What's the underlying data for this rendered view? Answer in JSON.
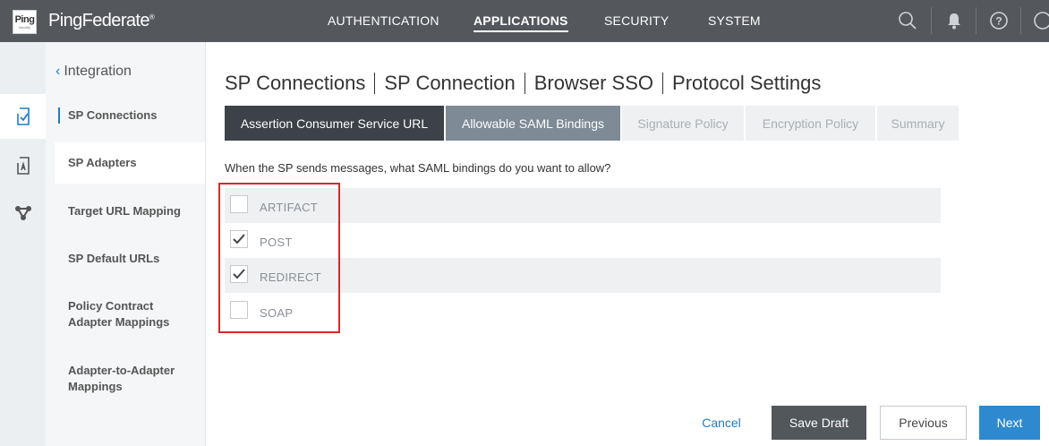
{
  "logo": {
    "line1": "Ping",
    "line2": "Identity"
  },
  "brand": {
    "name": "PingFederate",
    "mark": "®"
  },
  "topnav": {
    "items": [
      {
        "label": "AUTHENTICATION"
      },
      {
        "label": "APPLICATIONS",
        "active": true
      },
      {
        "label": "SECURITY"
      },
      {
        "label": "SYSTEM"
      }
    ],
    "icons": [
      "search-icon",
      "bell-icon",
      "help-icon",
      "user-icon"
    ]
  },
  "rail": {
    "icons": [
      "sp-connections-icon",
      "sp-adapters-icon",
      "federation-icon"
    ]
  },
  "subnav": {
    "back_label": "Integration",
    "items": [
      {
        "label": "SP Connections"
      },
      {
        "label": "SP Adapters"
      },
      {
        "label": "Target URL Mapping"
      },
      {
        "label": "SP Default URLs"
      },
      {
        "label": "Policy Contract Adapter Mappings"
      },
      {
        "label": "Adapter-to-Adapter Mappings"
      }
    ]
  },
  "breadcrumb": [
    "SP Connections",
    "SP Connection",
    "Browser SSO",
    "Protocol Settings"
  ],
  "tabs": [
    {
      "label": "Assertion Consumer Service URL",
      "state": "done"
    },
    {
      "label": "Allowable SAML Bindings",
      "state": "current"
    },
    {
      "label": "Signature Policy",
      "state": "future"
    },
    {
      "label": "Encryption Policy",
      "state": "future"
    },
    {
      "label": "Summary",
      "state": "future"
    }
  ],
  "question": "When the SP sends messages, what SAML bindings do you want to allow?",
  "bindings": [
    {
      "label": "ARTIFACT",
      "checked": false
    },
    {
      "label": "POST",
      "checked": true
    },
    {
      "label": "REDIRECT",
      "checked": true
    },
    {
      "label": "SOAP",
      "checked": false
    }
  ],
  "buttons": {
    "cancel": "Cancel",
    "save_draft": "Save Draft",
    "previous": "Previous",
    "next": "Next"
  },
  "colors": {
    "topbar": "#54575c",
    "accent": "#1f7dc2",
    "next": "#2e89cf",
    "highlight": "#d62a2a"
  }
}
